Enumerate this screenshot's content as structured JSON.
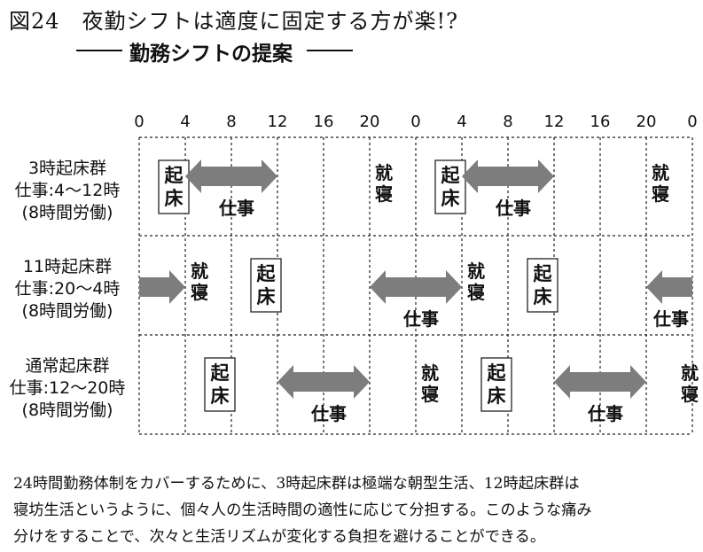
{
  "figure": {
    "title": "図24　夜勤シフトは適度に固定する方が楽!?",
    "subtitle": "勤務シフトの提案"
  },
  "hour_ticks": [
    "0",
    "4",
    "8",
    "12",
    "16",
    "20",
    "0",
    "4",
    "8",
    "12",
    "16",
    "20",
    "0"
  ],
  "rows": [
    {
      "label_lines": [
        "3時起床群",
        "仕事:4〜12時",
        "(8時間労働)"
      ],
      "wake_label": [
        "起",
        "床"
      ],
      "sleep_label": [
        "就",
        "寝"
      ],
      "work_label": "仕事",
      "wake_hours": [
        3,
        27
      ],
      "work_hours": [
        [
          4,
          12
        ],
        [
          28,
          36
        ]
      ],
      "sleep_hours": [
        20,
        44
      ]
    },
    {
      "label_lines": [
        "11時起床群",
        "仕事:20〜4時",
        "(8時間労働)"
      ],
      "wake_label": [
        "起",
        "床"
      ],
      "sleep_label": [
        "就",
        "寝"
      ],
      "work_label": "仕事",
      "wake_hours": [
        11,
        35
      ],
      "work_hours": [
        [
          0,
          4
        ],
        [
          20,
          28
        ],
        [
          44,
          48
        ]
      ],
      "sleep_hours": [
        4,
        28
      ]
    },
    {
      "label_lines": [
        "通常起床群",
        "仕事:12〜20時",
        "(8時間労働)"
      ],
      "wake_label": [
        "起",
        "床"
      ],
      "sleep_label": [
        "就",
        "寝"
      ],
      "work_label": "仕事",
      "wake_hours": [
        7,
        31
      ],
      "work_hours": [
        [
          12,
          20
        ],
        [
          36,
          44
        ]
      ],
      "sleep_hours": [
        24,
        48
      ]
    }
  ],
  "colors": {
    "arrow": "#7d7d7d",
    "line": "#222222",
    "text": "#111111"
  },
  "caption_lines": [
    "24時間勤務体制をカバーするために、3時起床群は極端な朝型生活、12時起床群は",
    "寝坊生活というように、個々人の生活時間の適性に応じて分担する。このような痛み",
    "分けをすることで、次々と生活リズムが変化する負担を避けることができる。"
  ]
}
